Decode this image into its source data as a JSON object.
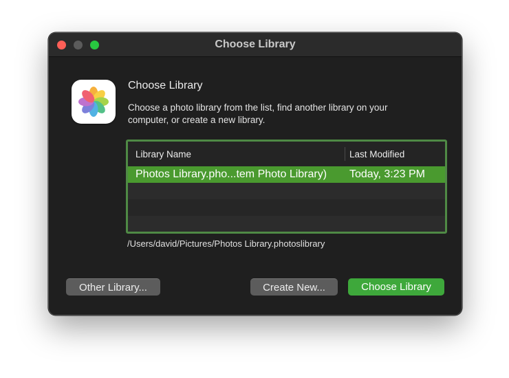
{
  "window": {
    "title": "Choose Library"
  },
  "dialog": {
    "app_icon": "photos-app-icon",
    "heading": "Choose Library",
    "description": "Choose a photo library from the list, find another library on your computer, or create a new library."
  },
  "table": {
    "columns": [
      "Library Name",
      "Last Modified"
    ],
    "rows": [
      {
        "name": "Photos Library.pho...tem Photo Library)",
        "modified": "Today, 3:23 PM",
        "selected": true
      }
    ]
  },
  "selected_path": "/Users/david/Pictures/Photos Library.photoslibrary",
  "buttons": {
    "other_library": "Other Library...",
    "create_new": "Create New...",
    "choose_library": "Choose Library"
  },
  "colors": {
    "accent": "#4a9a2f",
    "primary_button": "#3ea83b",
    "table_focus_ring": "#4f8a45",
    "close_light": "#ff5f57",
    "zoom_light": "#28c840"
  }
}
